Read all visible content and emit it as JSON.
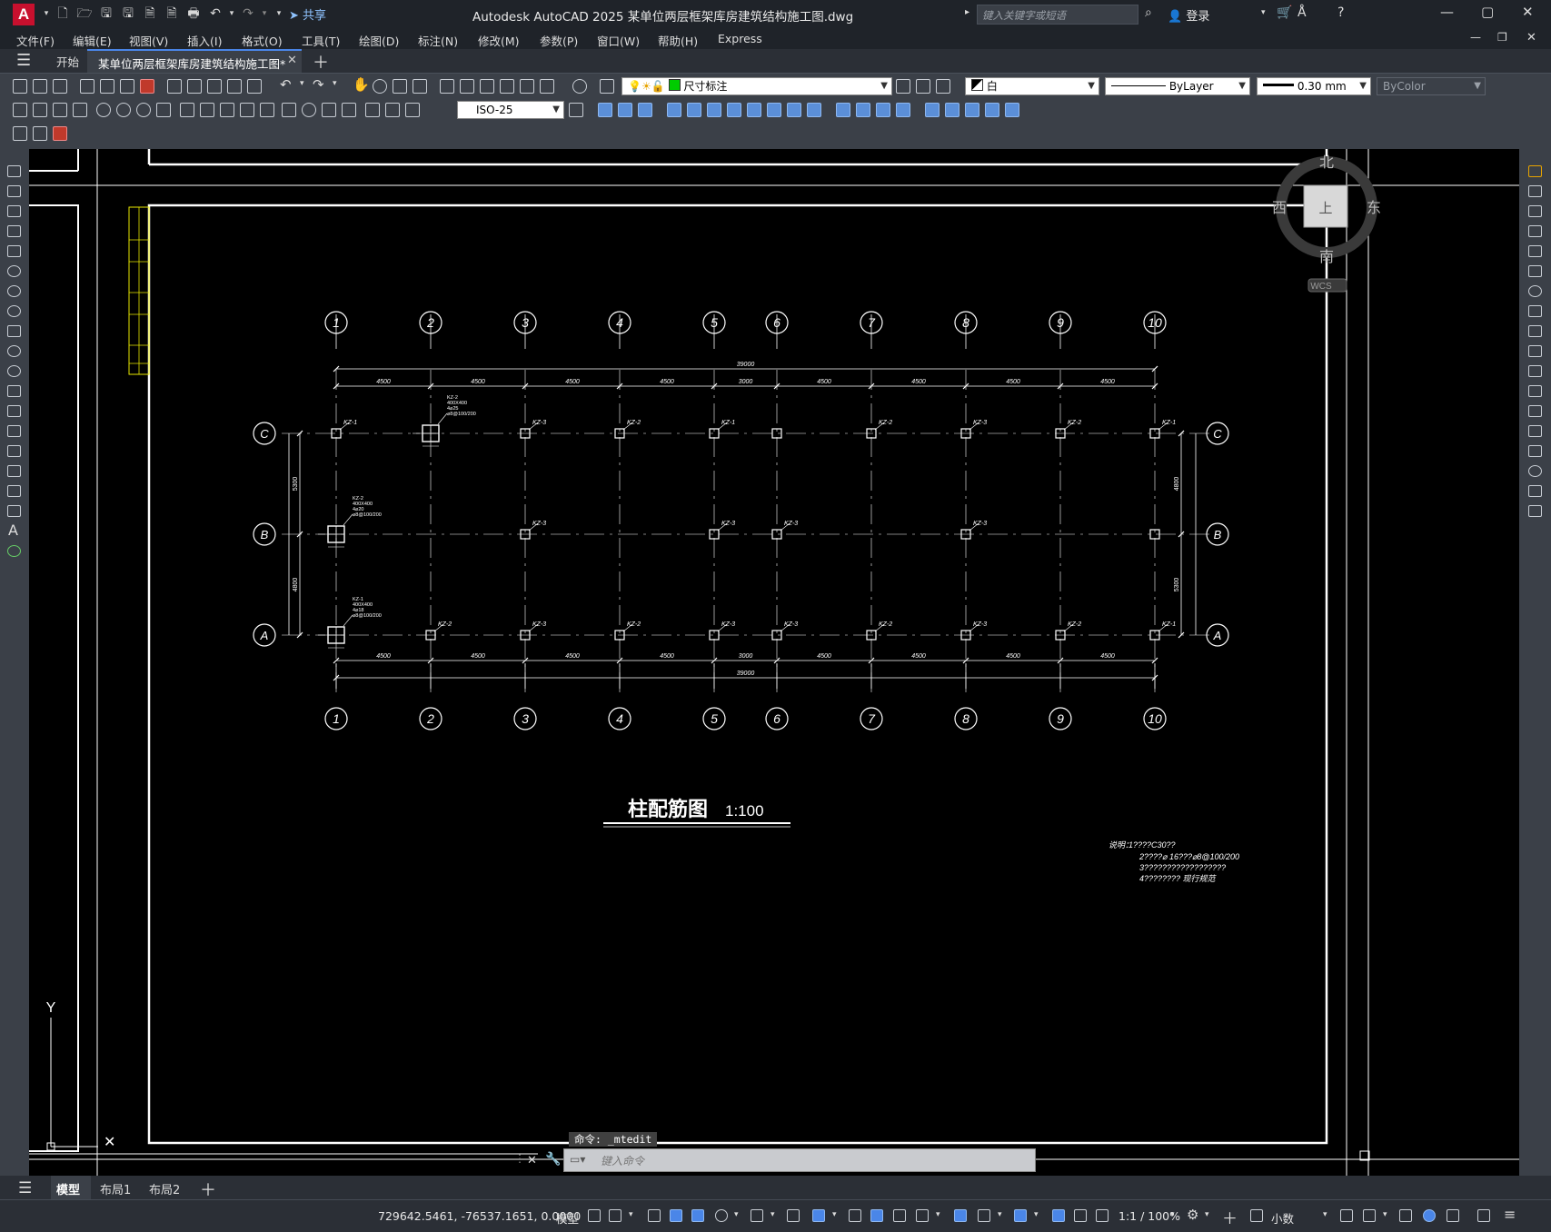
{
  "app": {
    "logo": "A",
    "title": "Autodesk AutoCAD 2025    某单位两层框架库房建筑结构施工图.dwg",
    "share_label": "共享",
    "search_placeholder": "键入关键字或短语",
    "login_label": "登录"
  },
  "menu": [
    "文件(F)",
    "编辑(E)",
    "视图(V)",
    "插入(I)",
    "格式(O)",
    "工具(T)",
    "绘图(D)",
    "标注(N)",
    "修改(M)",
    "参数(P)",
    "窗口(W)",
    "帮助(H)",
    "Express"
  ],
  "tabs": {
    "start": "开始",
    "document": "某单位两层框架库房建筑结构施工图*"
  },
  "properties": {
    "layer": "尺寸标注",
    "color": "白",
    "linetype": "ByLayer",
    "lineweight": "0.30 mm",
    "plotstyle": "ByColor",
    "dimstyle": "ISO-25",
    "layer_color": "#00cc00"
  },
  "viewcube": {
    "north": "北",
    "south": "南",
    "east": "东",
    "west": "西",
    "face": "上",
    "wcs": "WCS"
  },
  "drawing": {
    "title": "柱配筋图",
    "scale": "1:100",
    "axes_x": [
      "1",
      "2",
      "3",
      "4",
      "5",
      "6",
      "7",
      "8",
      "9",
      "10"
    ],
    "axes_y": [
      "C",
      "B",
      "A"
    ],
    "spans": [
      "4500",
      "4500",
      "4500",
      "4500",
      "3000",
      "4500",
      "4500",
      "4500",
      "4500"
    ],
    "total_length": "39000",
    "y_spans": [
      "4800",
      "5300"
    ],
    "y_left_dims": [
      "5300",
      "4800"
    ],
    "row_C_labels": [
      "KZ-1",
      "KZ-3",
      "KZ-2",
      "KZ-1",
      "KZ-2",
      "KZ-3",
      "KZ-2",
      "KZ-1"
    ],
    "row_B_labels": [
      "KZ-3",
      "KZ-3",
      "KZ-3",
      "KZ-3"
    ],
    "row_A_labels": [
      "KZ-2",
      "KZ-3",
      "KZ-2",
      "KZ-3",
      "KZ-3",
      "KZ-2",
      "KZ-3",
      "KZ-2",
      "KZ-1"
    ],
    "detail_kz2_top": [
      "KZ-2",
      "400X400",
      "4⌀25",
      "⌀8@100/200"
    ],
    "detail_kz2_mid": [
      "KZ-2",
      "400X400",
      "4⌀20",
      "⌀8@100/200"
    ],
    "detail_kz1": [
      "KZ-1",
      "400X400",
      "4⌀18",
      "⌀8@100/200"
    ],
    "notes_title": "说明：",
    "notes": [
      "1????C30??",
      "2????⌀  16???⌀8@100/200",
      "3??????????????????",
      "4???????? 现行规范"
    ],
    "ucs_y": "Y"
  },
  "command": {
    "history": "命令: _mtedit",
    "placeholder": "键入命令"
  },
  "layout_tabs": [
    "模型",
    "布局1",
    "布局2"
  ],
  "status": {
    "coords": "729642.5461, -76537.1651, 0.0000",
    "space": "模型",
    "annotation_scale": "1:1 / 100%",
    "units": "小数"
  }
}
